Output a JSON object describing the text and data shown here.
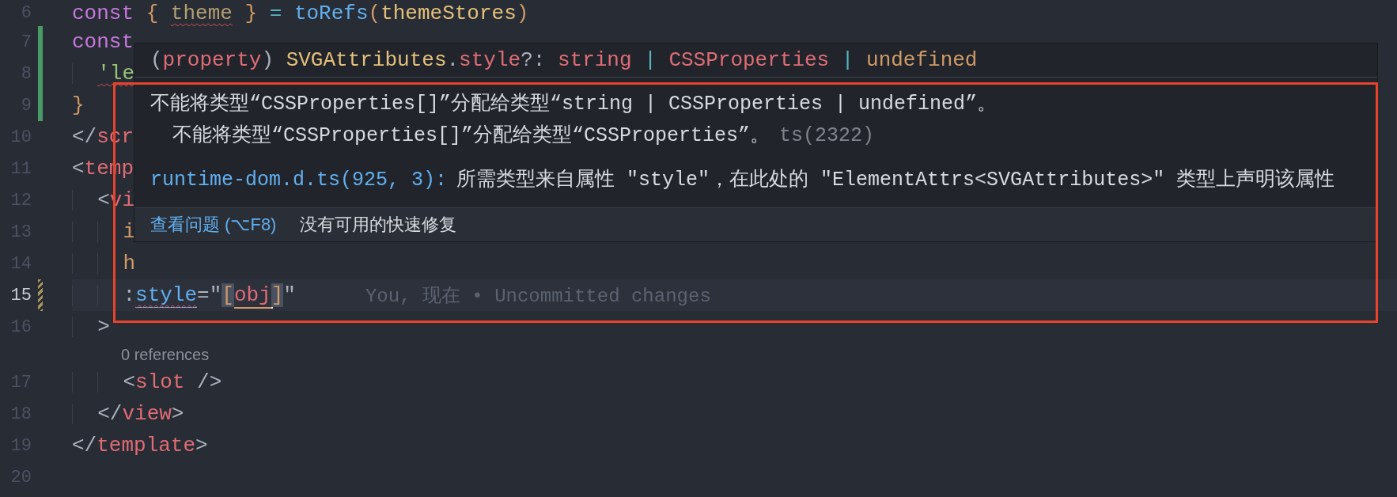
{
  "editor": {
    "lines": [
      {
        "kind": "code",
        "number": "6",
        "current": false,
        "added": false,
        "modified": false,
        "tokens": [
          {
            "text": "const ",
            "kind": "keyword"
          },
          {
            "text": "{ ",
            "kind": "brace"
          },
          {
            "text": "theme",
            "kind": "unused",
            "error": true
          },
          {
            "text": " } ",
            "kind": "brace"
          },
          {
            "text": "= ",
            "kind": "operator"
          },
          {
            "text": "toRefs",
            "kind": "function"
          },
          {
            "text": "(",
            "kind": "brace"
          },
          {
            "text": "themeStores",
            "kind": "variable"
          },
          {
            "text": ")",
            "kind": "brace"
          }
        ]
      },
      {
        "kind": "code",
        "number": "7",
        "current": false,
        "added": true,
        "modified": false,
        "tokens": [
          {
            "text": "const",
            "kind": "keyword"
          }
        ]
      },
      {
        "kind": "code",
        "number": "8",
        "current": false,
        "added": true,
        "modified": false,
        "tokens": [
          {
            "text": "  'le",
            "kind": "string",
            "error": true
          }
        ]
      },
      {
        "kind": "code",
        "number": "9",
        "current": false,
        "added": true,
        "modified": false,
        "tokens": [
          {
            "text": "}",
            "kind": "brace"
          }
        ]
      },
      {
        "kind": "code",
        "number": "10",
        "current": false,
        "added": false,
        "modified": false,
        "tokens": [
          {
            "text": "</",
            "kind": "plain"
          },
          {
            "text": "scr",
            "kind": "tag"
          }
        ]
      },
      {
        "kind": "code",
        "number": "11",
        "current": false,
        "added": false,
        "modified": false,
        "tokens": [
          {
            "text": "<",
            "kind": "plain"
          },
          {
            "text": "temp",
            "kind": "tag"
          }
        ]
      },
      {
        "kind": "code",
        "number": "12",
        "current": false,
        "added": false,
        "modified": false,
        "tokens": [
          {
            "text": "  <",
            "kind": "plain"
          },
          {
            "text": "vi",
            "kind": "tag"
          }
        ]
      },
      {
        "kind": "code",
        "number": "13",
        "current": false,
        "added": false,
        "modified": false,
        "tokens": [
          {
            "text": "    i",
            "kind": "attribute"
          }
        ]
      },
      {
        "kind": "code",
        "number": "14",
        "current": false,
        "added": false,
        "modified": false,
        "tokens": [
          {
            "text": "    h",
            "kind": "attribute"
          }
        ]
      },
      {
        "kind": "code",
        "number": "15",
        "current": true,
        "added": false,
        "modified": true,
        "tokens": [
          {
            "text": "    :",
            "kind": "plain"
          },
          {
            "text": "style",
            "kind": "function",
            "error": true,
            "link": true
          },
          {
            "text": "=\"",
            "kind": "plain"
          },
          {
            "text": "[",
            "kind": "brace",
            "matched": true
          },
          {
            "text": "obj",
            "kind": "property",
            "underlined": true,
            "cursor": true
          },
          {
            "text": "]",
            "kind": "brace",
            "matched": true
          },
          {
            "text": "\"",
            "kind": "plain"
          }
        ],
        "blame": "You, 现在 • Uncommitted changes"
      },
      {
        "kind": "code",
        "number": "16",
        "current": false,
        "added": false,
        "modified": false,
        "tokens": [
          {
            "text": "  >",
            "kind": "plain"
          }
        ]
      },
      {
        "kind": "codelens",
        "text": "0 references"
      },
      {
        "kind": "code",
        "number": "17",
        "current": false,
        "added": false,
        "modified": false,
        "tokens": [
          {
            "text": "    <",
            "kind": "plain"
          },
          {
            "text": "slot ",
            "kind": "tag"
          },
          {
            "text": "/>",
            "kind": "plain"
          }
        ]
      },
      {
        "kind": "code",
        "number": "18",
        "current": false,
        "added": false,
        "modified": false,
        "tokens": [
          {
            "text": "  </",
            "kind": "plain"
          },
          {
            "text": "view",
            "kind": "tag"
          },
          {
            "text": ">",
            "kind": "plain"
          }
        ]
      },
      {
        "kind": "code",
        "number": "19",
        "current": false,
        "added": false,
        "modified": false,
        "tokens": [
          {
            "text": "</",
            "kind": "plain"
          },
          {
            "text": "template",
            "kind": "tag"
          },
          {
            "text": ">",
            "kind": "plain"
          }
        ]
      },
      {
        "kind": "code",
        "number": "20",
        "current": false,
        "added": false,
        "modified": false
      }
    ]
  },
  "hover": {
    "signature": [
      {
        "text": "(",
        "kind": "plain"
      },
      {
        "text": "property",
        "kind": "property"
      },
      {
        "text": ") ",
        "kind": "plain"
      },
      {
        "text": "SVGAttributes",
        "kind": "variable"
      },
      {
        "text": ".",
        "kind": "plain"
      },
      {
        "text": "style",
        "kind": "property"
      },
      {
        "text": "?: ",
        "kind": "plain"
      },
      {
        "text": "string ",
        "kind": "property"
      },
      {
        "text": "| ",
        "kind": "operator"
      },
      {
        "text": "CSSProperties ",
        "kind": "property"
      },
      {
        "text": "| ",
        "kind": "operator"
      },
      {
        "text": "undefined",
        "kind": "literal"
      }
    ],
    "messages": [
      {
        "text": "不能将类型“CSSProperties[]”分配给类型“string | CSSProperties | undefined”。",
        "children": [
          {
            "text": "不能将类型“CSSProperties[]”分配给类型“CSSProperties”。",
            "code": "ts(2322)"
          }
        ]
      }
    ],
    "related": {
      "link": "runtime-dom.d.ts(925, 3):",
      "text": "所需类型来自属性 \"style\"，在此处的 \"ElementAttrs<SVGAttributes>\" 类型上声明该属性"
    },
    "footer": {
      "link": "查看问题 (⌥F8)",
      "text": "没有可用的快速修复"
    }
  },
  "annotation": {
    "highlight_box": true
  }
}
